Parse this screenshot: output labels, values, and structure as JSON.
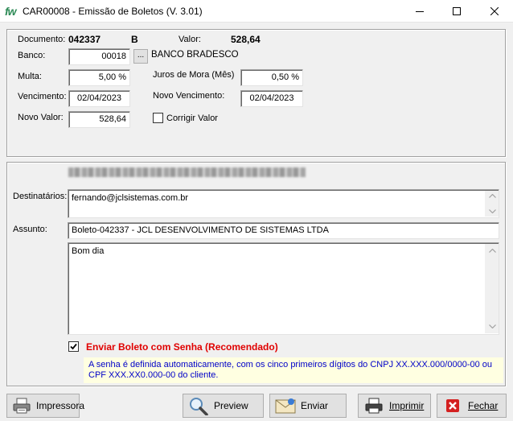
{
  "window": {
    "app_icon": "fw",
    "title": "CAR00008 - Emissão de Boletos (V. 3.01)",
    "minimize_icon": "minimize-icon",
    "maximize_icon": "maximize-icon",
    "close_icon": "close-icon"
  },
  "header": {
    "documento_label": "Documento:",
    "documento_value": "042337",
    "documento_suffix": "B",
    "valor_label": "Valor:",
    "valor_value": "528,64",
    "banco_label": "Banco:",
    "banco_code": "00018",
    "banco_browse": "...",
    "banco_name": "BANCO BRADESCO",
    "multa_label": "Multa:",
    "multa_value": "5,00 %",
    "juros_label": "Juros de Mora (Mês)",
    "juros_value": "0,50 %",
    "vencimento_label": "Vencimento:",
    "vencimento_value": "02/04/2023",
    "novo_vencimento_label": "Novo Vencimento:",
    "novo_vencimento_value": "02/04/2023",
    "novo_valor_label": "Novo Valor:",
    "novo_valor_value": "528,64",
    "corrigir_label": "Corrigir Valor",
    "corrigir_checked": false
  },
  "email": {
    "destinatarios_label": "Destinatários:",
    "destinatarios_value": "fernando@jclsistemas.com.br",
    "assunto_label": "Assunto:",
    "assunto_value": "Boleto-042337 - JCL DESENVOLVIMENTO DE SISTEMAS LTDA",
    "body_value": "Bom dia",
    "senha_checked": true,
    "senha_label": "Enviar Boleto com Senha (Recomendado)",
    "senha_info": "A senha é definida automaticamente, com os cinco primeiros dígitos do CNPJ XX.XXX.000/0000-00 ou CPF XXX.XX0.000-00 do cliente."
  },
  "buttons": {
    "impressora": "Impressora",
    "preview": "Preview",
    "enviar": "Enviar",
    "imprimir": "Imprimir",
    "fechar": "Fechar"
  },
  "colors": {
    "warning": "#e00000",
    "info_text": "#0000c8",
    "info_bg": "#ffffe1"
  }
}
